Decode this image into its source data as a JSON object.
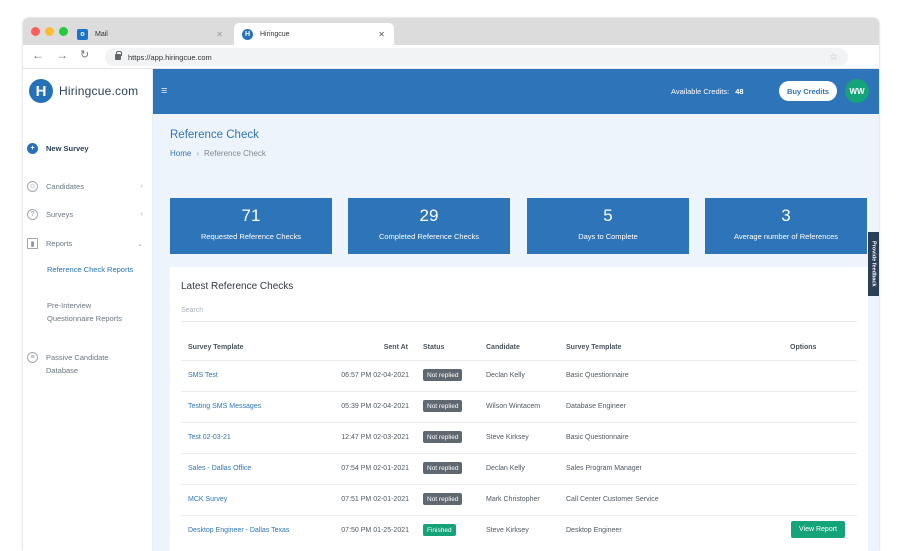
{
  "browser": {
    "tabs": [
      {
        "label": "Mail"
      },
      {
        "label": "Hiringcue"
      }
    ],
    "url": "https://app.hiringcue.com"
  },
  "brand": {
    "logo_letter": "H",
    "name": "Hiringcue.com"
  },
  "sidebar": {
    "items": [
      {
        "label": "New Survey"
      },
      {
        "label": "Candidates"
      },
      {
        "label": "Surveys"
      },
      {
        "label": "Reports"
      },
      {
        "label": "Passive Candidate Database"
      }
    ],
    "report_subitems": [
      {
        "label": "Reference Check Reports"
      },
      {
        "label": "Pre-Interview Questionnaire Reports"
      }
    ]
  },
  "topbar": {
    "credits_label": "Available Credits:",
    "credits_value": "48",
    "buy_label": "Buy Credits",
    "avatar_initials": "WW"
  },
  "page": {
    "title": "Reference Check",
    "breadcrumb": {
      "home": "Home",
      "current": "Reference Check"
    }
  },
  "stats": [
    {
      "value": "71",
      "label": "Requested Reference Checks"
    },
    {
      "value": "29",
      "label": "Completed Reference Checks"
    },
    {
      "value": "5",
      "label": "Days to Complete"
    },
    {
      "value": "3",
      "label": "Average number of References"
    }
  ],
  "feedback_label": "Provide feedback",
  "table": {
    "title": "Latest Reference Checks",
    "search_placeholder": "Search",
    "headers": {
      "template": "Survey Template",
      "sent": "Sent At",
      "status": "Status",
      "candidate": "Candidate",
      "survey_template": "Survey Template",
      "options": "Options"
    },
    "rows": [
      {
        "template": "SMS Test",
        "sent": "06:57 PM 02-04-2021",
        "status": "Not replied",
        "candidate": "Declan Kelly",
        "survey_template": "Basic Questionnaire",
        "option": ""
      },
      {
        "template": "Testing SMS Messages",
        "sent": "05:39 PM 02-04-2021",
        "status": "Not replied",
        "candidate": "Wilson Wintacem",
        "survey_template": "Database Engineer",
        "option": ""
      },
      {
        "template": "Test 02-03-21",
        "sent": "12:47 PM 02-03-2021",
        "status": "Not replied",
        "candidate": "Steve Kirksey",
        "survey_template": "Basic Questionnaire",
        "option": ""
      },
      {
        "template": "Sales - Dallas Office",
        "sent": "07:54 PM 02-01-2021",
        "status": "Not replied",
        "candidate": "Declan Kelly",
        "survey_template": "Sales Program Manager",
        "option": ""
      },
      {
        "template": "MCK Survey",
        "sent": "07:51 PM 02-01-2021",
        "status": "Not replied",
        "candidate": "Mark Christopher",
        "survey_template": "Call Center Customer Service",
        "option": ""
      },
      {
        "template": "Desktop Engineer - Dallas Texas",
        "sent": "07:50 PM 01-25-2021",
        "status": "Finished",
        "candidate": "Steve Kirksey",
        "survey_template": "Desktop Engineer",
        "option": "View Report"
      }
    ]
  },
  "colors": {
    "primary": "#2e74b8",
    "success": "#15a37a",
    "muted_badge": "#5f6870"
  },
  "icons": {
    "new_survey": "plus-circle-icon",
    "candidates": "users-icon",
    "surveys": "question-circle-icon",
    "reports": "bar-chart-icon",
    "passive": "layers-icon"
  }
}
